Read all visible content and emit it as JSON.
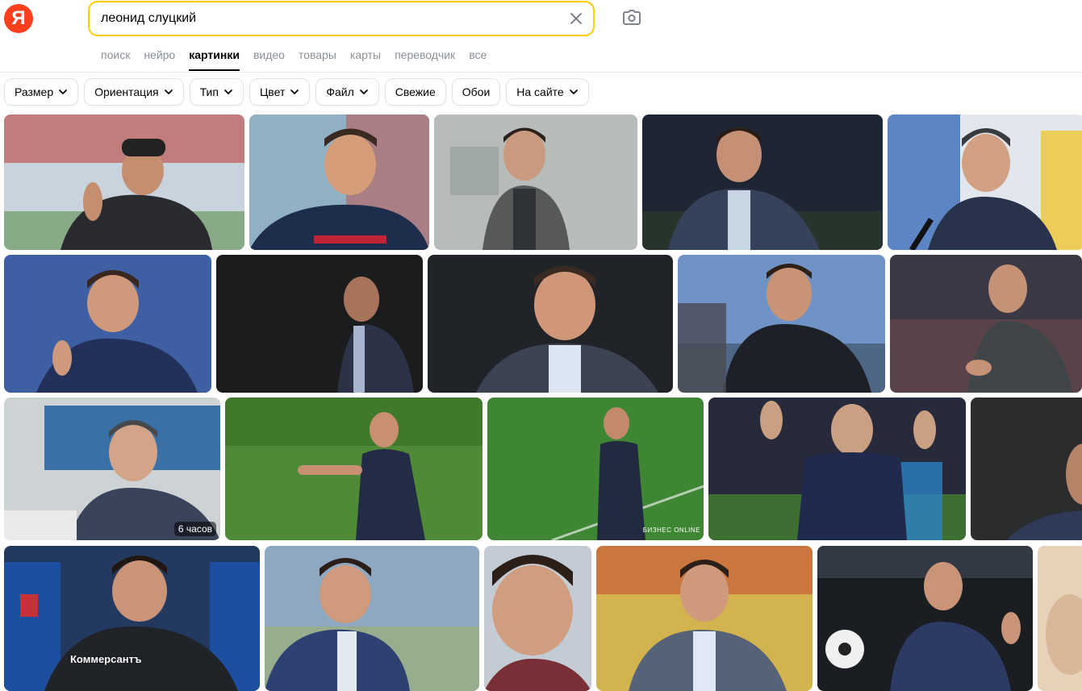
{
  "header": {
    "logo_letter": "Я",
    "search": {
      "value": "леонид слуцкий"
    }
  },
  "tabs": [
    {
      "label": "поиск",
      "active": false
    },
    {
      "label": "нейро",
      "active": false
    },
    {
      "label": "картинки",
      "active": true
    },
    {
      "label": "видео",
      "active": false
    },
    {
      "label": "товары",
      "active": false
    },
    {
      "label": "карты",
      "active": false
    },
    {
      "label": "переводчик",
      "active": false
    },
    {
      "label": "все",
      "active": false
    }
  ],
  "filters": [
    {
      "label": "Размер",
      "dropdown": true
    },
    {
      "label": "Ориентация",
      "dropdown": true
    },
    {
      "label": "Тип",
      "dropdown": true
    },
    {
      "label": "Цвет",
      "dropdown": true
    },
    {
      "label": "Файл",
      "dropdown": true
    },
    {
      "label": "Свежие",
      "dropdown": false
    },
    {
      "label": "Обои",
      "dropdown": false
    },
    {
      "label": "На сайте",
      "dropdown": true
    }
  ],
  "results": {
    "badge_text": "6 часов",
    "watermark_kommersant": "Коммерсантъ",
    "watermark_business_online": "БИЗНЕС ONLINE"
  },
  "colors": {
    "accent_yellow": "#ffcc00",
    "logo_red": "#fc3f1d",
    "tab_inactive": "#8a8f99"
  }
}
